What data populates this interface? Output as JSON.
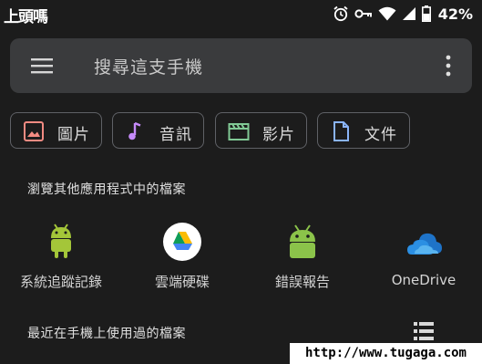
{
  "status_bar": {
    "time": "上頭嗎",
    "battery_percent": "42%",
    "icons": [
      "alarm-icon",
      "vpn-key-icon",
      "wifi-icon",
      "signal-icon",
      "battery-icon"
    ]
  },
  "search_bar": {
    "placeholder": "搜尋這支手機",
    "menu_icon": "hamburger-menu-icon",
    "more_icon": "more-vert-icon"
  },
  "categories": [
    {
      "label": "圖片",
      "icon": "image-icon",
      "color": "#f28b82"
    },
    {
      "label": "音訊",
      "icon": "music-note-icon",
      "color": "#c58af9"
    },
    {
      "label": "影片",
      "icon": "movie-icon",
      "color": "#81c995"
    },
    {
      "label": "文件",
      "icon": "document-icon",
      "color": "#8ab4f8"
    }
  ],
  "other_apps": {
    "title": "瀏覽其他應用程式中的檔案",
    "apps": [
      {
        "label": "系統追蹤記錄",
        "icon": "android-icon"
      },
      {
        "label": "雲端硬碟",
        "icon": "google-drive-icon"
      },
      {
        "label": "錯誤報告",
        "icon": "android-icon"
      },
      {
        "label": "OneDrive",
        "icon": "onedrive-icon"
      }
    ]
  },
  "recent": {
    "title": "最近在手機上使用過的檔案",
    "view_toggle_icon": "list-view-icon"
  },
  "watermark": "http://www.tugaga.com"
}
